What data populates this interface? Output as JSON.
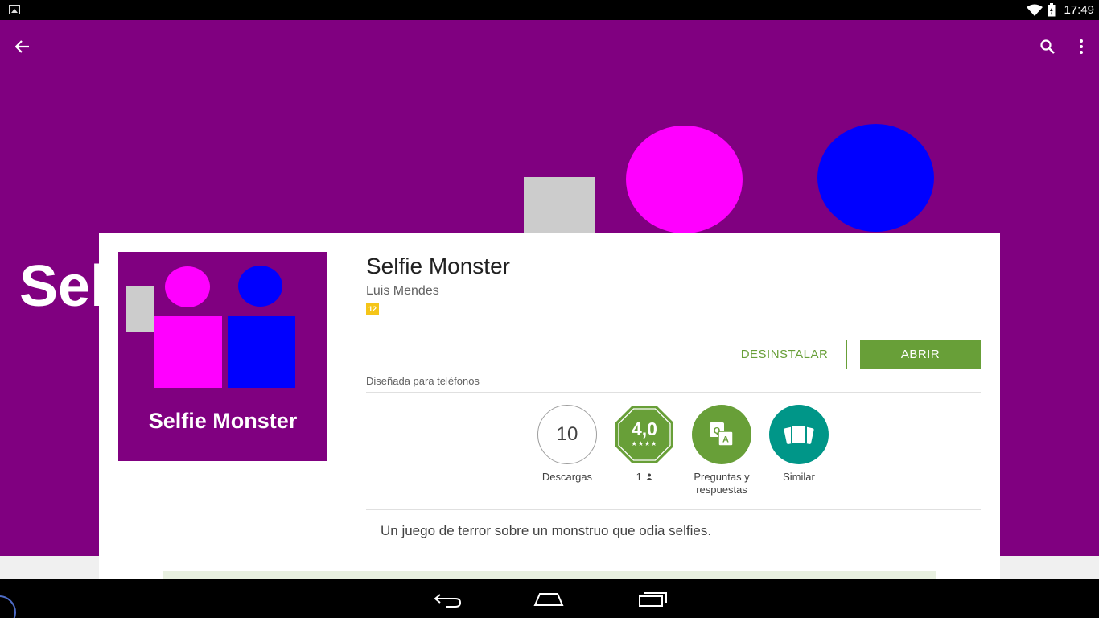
{
  "status_bar": {
    "time": "17:49"
  },
  "banner": {
    "text": "Selfie Monster"
  },
  "app": {
    "title": "Selfie Monster",
    "developer": "Luis Mendes",
    "age_rating": "12",
    "icon_text": "Selfie Monster"
  },
  "buttons": {
    "uninstall": "DESINSTALAR",
    "open": "ABRIR"
  },
  "designed_for": "Diseñada para teléfonos",
  "stats": {
    "downloads_value": "10",
    "downloads_label": "Descargas",
    "rating_value": "4,0",
    "rating_stars": "★★★★",
    "rating_count": "1",
    "qa_label_line1": "Preguntas y",
    "qa_label_line2": "respuestas",
    "similar_label": "Similar"
  },
  "description": "Un juego de terror sobre un monstruo que odia selfies.",
  "colors": {
    "banner": "#800080",
    "accent_green": "#689f38",
    "similar_teal": "#009688",
    "age_badge": "#f5c518"
  },
  "icons": [
    "image-icon",
    "wifi-icon",
    "battery-icon",
    "back-arrow-icon",
    "search-icon",
    "more-vert-icon",
    "person-icon",
    "qa-icon",
    "similar-cards-icon",
    "nav-back-icon",
    "nav-home-icon",
    "nav-recents-icon"
  ]
}
